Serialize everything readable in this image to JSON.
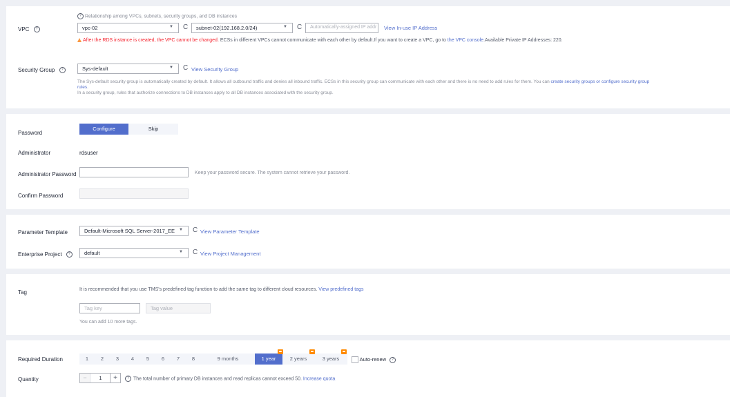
{
  "network": {
    "hint": "Relationship among VPCs, subnets, security groups, and DB instances",
    "vpc_label": "VPC",
    "vpc_value": "vpc-02",
    "subnet_value": "subnet-02(192.168.2.0/24)",
    "ip_placeholder": "Automatically-assigned IP addr",
    "view_ip_link": "View In-use IP Address",
    "warning_red": "After the RDS instance is created, the VPC cannot be changed.",
    "warning_rest": " ECSs in different VPCs cannot communicate with each other by default.If you want to create a VPC, go to ",
    "vpc_console_link": "the VPC console",
    "warning_tail": ".Available Private IP Addresses: 220.",
    "sg_label": "Security Group",
    "sg_value": "Sys-default",
    "view_sg_link": "View Security Group",
    "sg_desc_1": "The Sys-default security group is automatically created by default. It allows all outbound traffic and denies all inbound traffic. ECSs in this security group can communicate with each other and there is no need to add rules for them. You can ",
    "sg_desc_link": "create security groups or configure security group",
    "sg_desc_link_2": "rules",
    "sg_desc_link_end": ".",
    "sg_desc_2": "In a security group, rules that authorize connections to DB instances apply to all DB instances associated with the security group."
  },
  "password": {
    "label": "Password",
    "configure": "Configure",
    "skip": "Skip",
    "admin_label": "Administrator",
    "admin_value": "rdsuser",
    "admin_pw_label": "Administrator Password",
    "admin_pw_hint": "Keep your password secure. The system cannot retrieve your password.",
    "confirm_label": "Confirm Password"
  },
  "params": {
    "template_label": "Parameter Template",
    "template_value": "Default-Microsoft SQL Server-2017_EE",
    "view_template_link": "View Parameter Template",
    "project_label": "Enterprise Project",
    "project_value": "default",
    "view_project_link": "View Project Management"
  },
  "tag": {
    "label": "Tag",
    "desc": "It is recommended that you use TMS's predefined tag function to add the same tag to different cloud resources. ",
    "desc_link": "View predefined tags",
    "key_placeholder": "Tag key",
    "value_placeholder": "Tag value",
    "remaining": "You can add 10 more tags."
  },
  "purchase": {
    "duration_label": "Required Duration",
    "durations": [
      "1",
      "2",
      "3",
      "4",
      "5",
      "6",
      "7",
      "8",
      "9 months",
      "1 year",
      "2 years",
      "3 years"
    ],
    "selected_duration": "1 year",
    "auto_renew": "Auto-renew",
    "quantity_label": "Quantity",
    "quantity_value": "1",
    "minus": "−",
    "plus": "+",
    "quantity_hint": "The total number of primary DB instances and read replicas cannot exceed 50. ",
    "increase_quota": "Increase quota"
  },
  "icons": {
    "help": "?",
    "refresh": "C",
    "caret": "▼"
  },
  "colors": {
    "accent": "#526ecc",
    "warning_red": "#f5222d",
    "badge_orange": "#ff8a00"
  }
}
